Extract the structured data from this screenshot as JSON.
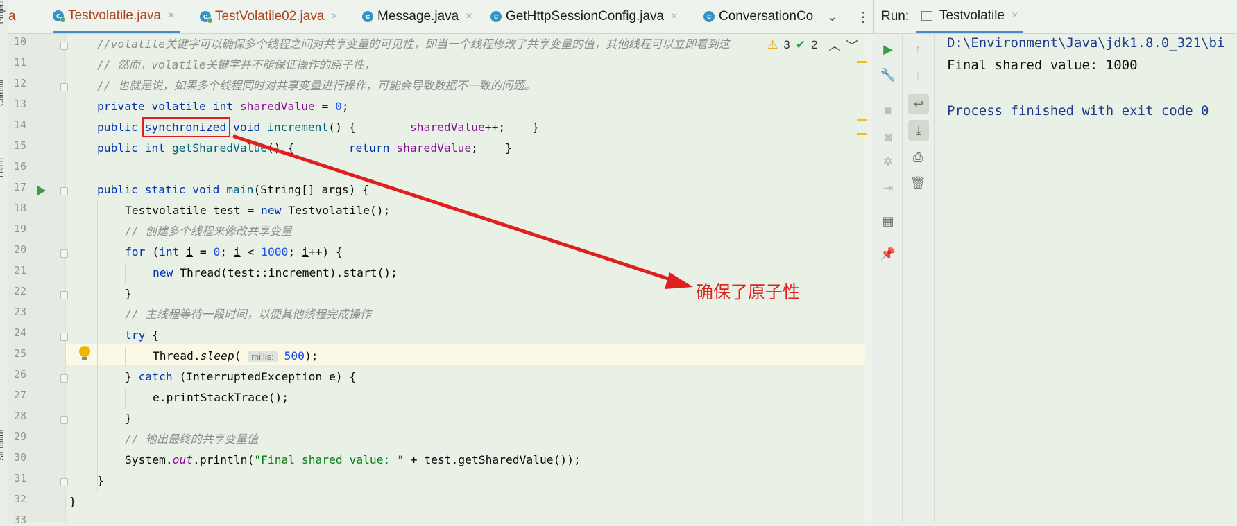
{
  "left_strip": {
    "labels": [
      "Project",
      "Commit",
      "Learn",
      "Structure"
    ]
  },
  "tabs": [
    {
      "label": "a",
      "modified": true,
      "close": ""
    },
    {
      "label": "Testvolatile.java",
      "modified": true,
      "active": true,
      "close": "×"
    },
    {
      "label": "TestVolatile02.java",
      "modified": true,
      "close": "×"
    },
    {
      "label": "Message.java",
      "close": "×"
    },
    {
      "label": "GetHttpSessionConfig.java",
      "close": "×"
    },
    {
      "label": "ConversationCo",
      "close": ""
    }
  ],
  "inspections": {
    "warnings": "3",
    "checks": "2"
  },
  "line_numbers": [
    "10",
    "11",
    "12",
    "13",
    "14",
    "15",
    "16",
    "17",
    "18",
    "19",
    "20",
    "21",
    "22",
    "23",
    "24",
    "25",
    "26",
    "27",
    "28",
    "29",
    "30",
    "31",
    "32",
    "33"
  ],
  "code": {
    "l10": "//volatile关键字可以确保多个线程之间对共享变量的可见性，即当一个线程修改了共享变量的值，其他线程可以立即看到这",
    "l11": "// 然而，volatile关键字并不能保证操作的原子性，",
    "l12": "// 也就是说，如果多个线程同时对共享变量进行操作，可能会导致数据不一致的问题。",
    "l19": "// 创建多个线程来修改共享变量",
    "l23": "// 主线程等待一段时间，以便其他线程完成操作",
    "l29": "// 输出最终的共享变量值",
    "hint_millis": "millis:",
    "println_str": "\"Final shared value: \""
  },
  "run": {
    "label": "Run:",
    "tab": "Testvolatile",
    "close": "×",
    "console": [
      "D:\\Environment\\Java\\jdk1.8.0_321\\bi",
      "Final shared value: 1000",
      "",
      "Process finished with exit code 0"
    ]
  },
  "annotation": {
    "text": "确保了原子性"
  },
  "colors": {
    "accent": "#4a88c7",
    "annotation": "#e0201f",
    "background": "#e9f1e7"
  }
}
